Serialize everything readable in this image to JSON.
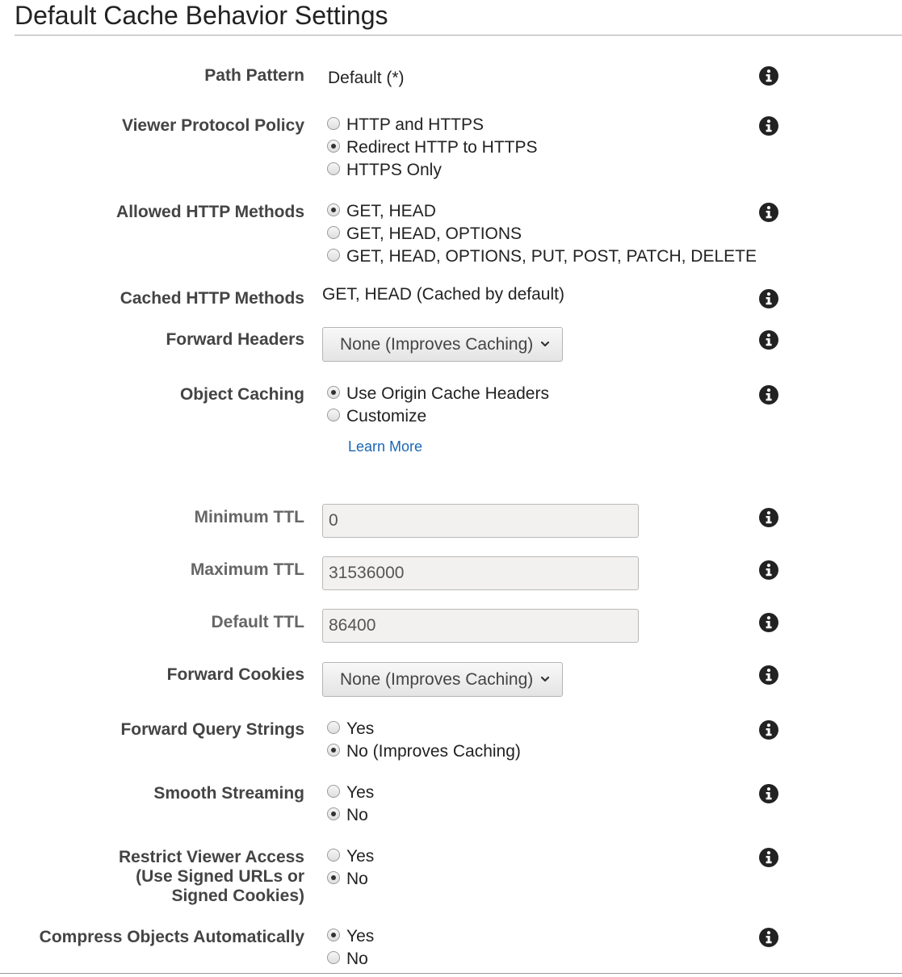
{
  "title": "Default Cache Behavior Settings",
  "colors": {
    "link": "#1a67b3",
    "label": "#444444",
    "disabled_label": "#666666",
    "input_background": "#f2f1ef"
  },
  "info_icon": "info-circle-icon",
  "path_pattern": {
    "label": "Path Pattern",
    "value": "Default (*)"
  },
  "viewer_protocol_policy": {
    "label": "Viewer Protocol Policy",
    "options": [
      "HTTP and HTTPS",
      "Redirect HTTP to HTTPS",
      "HTTPS Only"
    ],
    "selected": "Redirect HTTP to HTTPS"
  },
  "allowed_http_methods": {
    "label": "Allowed HTTP Methods",
    "options": [
      "GET, HEAD",
      "GET, HEAD, OPTIONS",
      "GET, HEAD, OPTIONS, PUT, POST, PATCH, DELETE"
    ],
    "selected": "GET, HEAD"
  },
  "cached_http_methods": {
    "label": "Cached HTTP Methods",
    "value": "GET, HEAD (Cached by default)"
  },
  "forward_headers": {
    "label": "Forward Headers",
    "selected": "None (Improves Caching)"
  },
  "object_caching": {
    "label": "Object Caching",
    "options": [
      "Use Origin Cache Headers",
      "Customize"
    ],
    "selected": "Use Origin Cache Headers",
    "learn_more": "Learn More"
  },
  "minimum_ttl": {
    "label": "Minimum TTL",
    "value": "0"
  },
  "maximum_ttl": {
    "label": "Maximum TTL",
    "value": "31536000"
  },
  "default_ttl": {
    "label": "Default TTL",
    "value": "86400"
  },
  "forward_cookies": {
    "label": "Forward Cookies",
    "selected": "None (Improves Caching)"
  },
  "forward_query_strings": {
    "label": "Forward Query Strings",
    "options": [
      "Yes",
      "No (Improves Caching)"
    ],
    "selected": "No (Improves Caching)"
  },
  "smooth_streaming": {
    "label": "Smooth Streaming",
    "options": [
      "Yes",
      "No"
    ],
    "selected": "No"
  },
  "restrict_viewer_access": {
    "label": "Restrict Viewer Access\n(Use Signed URLs or\nSigned Cookies)",
    "options": [
      "Yes",
      "No"
    ],
    "selected": "No"
  },
  "compress_objects": {
    "label": "Compress Objects Automatically",
    "options": [
      "Yes",
      "No"
    ],
    "selected": "Yes"
  }
}
